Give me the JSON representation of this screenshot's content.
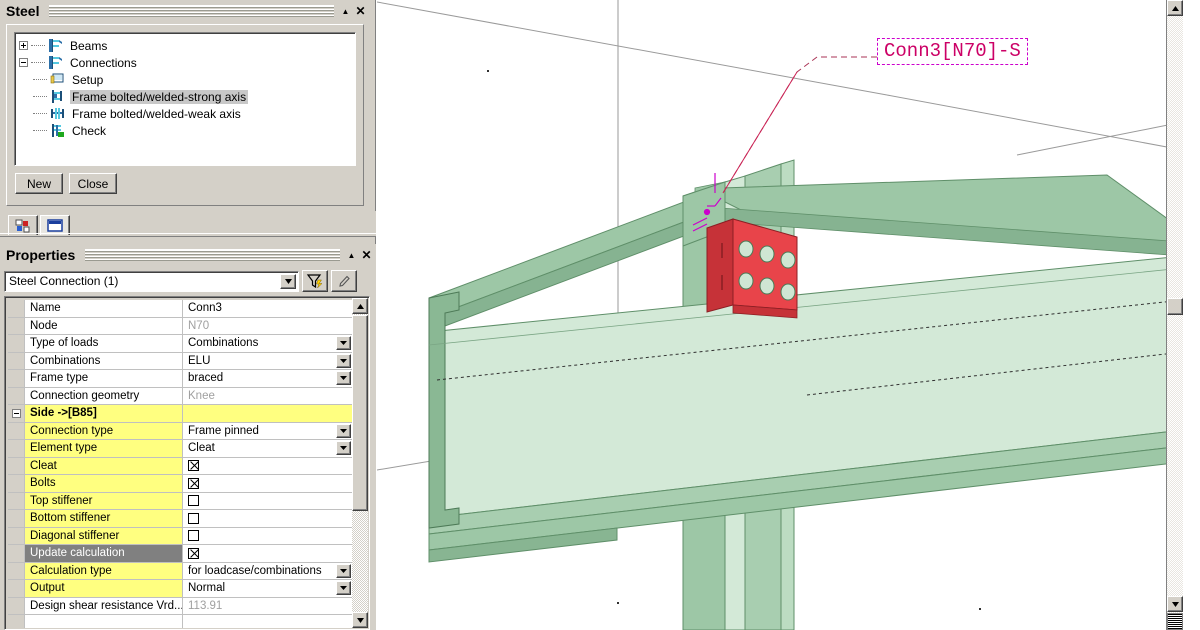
{
  "steel_panel": {
    "title": "Steel",
    "collapse_icon": "caret-up-icon",
    "close_icon": "close-icon",
    "tree": [
      {
        "label": "Beams",
        "icon": "ibeam-icon",
        "expander": "plus",
        "depth": 0,
        "selected": false
      },
      {
        "label": "Connections",
        "icon": "ibeam-icon",
        "expander": "minus",
        "depth": 0,
        "selected": false
      },
      {
        "label": "Setup",
        "icon": "setup-icon",
        "expander": "none",
        "depth": 1,
        "selected": false
      },
      {
        "label": "Frame bolted/welded-strong axis",
        "icon": "strong-axis-icon",
        "expander": "none",
        "depth": 1,
        "selected": true
      },
      {
        "label": "Frame bolted/welded-weak axis",
        "icon": "weak-axis-icon",
        "expander": "none",
        "depth": 1,
        "selected": false
      },
      {
        "label": "Check",
        "icon": "check-beam-icon",
        "expander": "none",
        "depth": 1,
        "selected": false
      }
    ],
    "buttons": [
      {
        "label": "New"
      },
      {
        "label": "Close"
      }
    ]
  },
  "tab_strip": {
    "tabs": [
      {
        "name": "properties-tab",
        "icon": "multi-select-icon",
        "active": false
      },
      {
        "name": "window-tab",
        "icon": "window-icon",
        "active": true
      }
    ]
  },
  "properties_panel": {
    "title": "Properties",
    "collapse_icon": "caret-up-icon",
    "close_icon": "close-icon",
    "selector": {
      "value": "Steel Connection (1)",
      "dropdown_icon": "chevron-down-icon"
    },
    "toolbar": [
      {
        "name": "filter-button",
        "icon": "filter-funnel-icon"
      },
      {
        "name": "edit-button",
        "icon": "pencil-icon"
      }
    ],
    "rows": [
      {
        "name": "Name",
        "value": "Conn3",
        "kind": "text",
        "style": "normal",
        "gutter": "none"
      },
      {
        "name": "Node",
        "value": "N70",
        "kind": "readonly",
        "style": "normal",
        "gutter": "none"
      },
      {
        "name": "Type of loads",
        "value": "Combinations",
        "kind": "dropdown",
        "style": "normal",
        "gutter": "none"
      },
      {
        "name": "Combinations",
        "value": "ELU",
        "kind": "dropdown",
        "style": "normal",
        "gutter": "none"
      },
      {
        "name": "Frame type",
        "value": "braced",
        "kind": "dropdown",
        "style": "normal",
        "gutter": "none"
      },
      {
        "name": "Connection geometry",
        "value": "Knee",
        "kind": "readonly",
        "style": "normal",
        "gutter": "none"
      },
      {
        "name": "Side ->[B85]",
        "value": "",
        "kind": "text",
        "style": "group",
        "gutter": "minus"
      },
      {
        "name": "Connection type",
        "value": "Frame pinned",
        "kind": "dropdown",
        "style": "yellow",
        "gutter": "none"
      },
      {
        "name": "Element  type",
        "value": "Cleat",
        "kind": "dropdown",
        "style": "yellow",
        "gutter": "none"
      },
      {
        "name": "Cleat",
        "value": "checked",
        "kind": "checkbox",
        "style": "yellow",
        "gutter": "none"
      },
      {
        "name": "Bolts",
        "value": "checked",
        "kind": "checkbox",
        "style": "yellow",
        "gutter": "none"
      },
      {
        "name": "Top stiffener",
        "value": "unchecked",
        "kind": "checkbox",
        "style": "yellow",
        "gutter": "none"
      },
      {
        "name": "Bottom stiffener",
        "value": "unchecked",
        "kind": "checkbox",
        "style": "yellow",
        "gutter": "none"
      },
      {
        "name": "Diagonal stiffener",
        "value": "unchecked",
        "kind": "checkbox",
        "style": "yellow",
        "gutter": "none"
      },
      {
        "name": "Update calculation",
        "value": "checked",
        "kind": "checkbox",
        "style": "selected",
        "gutter": "none"
      },
      {
        "name": "Calculation type",
        "value": "for loadcase/combinations",
        "kind": "dropdown",
        "style": "yellow",
        "gutter": "none"
      },
      {
        "name": "Output",
        "value": "Normal",
        "kind": "dropdown",
        "style": "yellow",
        "gutter": "none"
      },
      {
        "name": "Design shear resistance Vrd...",
        "value": "113.91",
        "kind": "readonly",
        "style": "normal",
        "gutter": "none"
      }
    ],
    "scrollbar": {
      "up_icon": "scroll-up-icon",
      "down_icon": "scroll-down-icon"
    }
  },
  "viewport": {
    "connection_label": "Conn3[N70]-S",
    "label_color": "#cc0066",
    "label_border_color": "#cc00cc",
    "steel_color": "#a8ceb0",
    "cleat_color": "#e8444a",
    "background": "#ffffff",
    "scrollbar": {
      "up_icon": "scroll-up-icon",
      "down_icon": "scroll-down-icon"
    }
  }
}
